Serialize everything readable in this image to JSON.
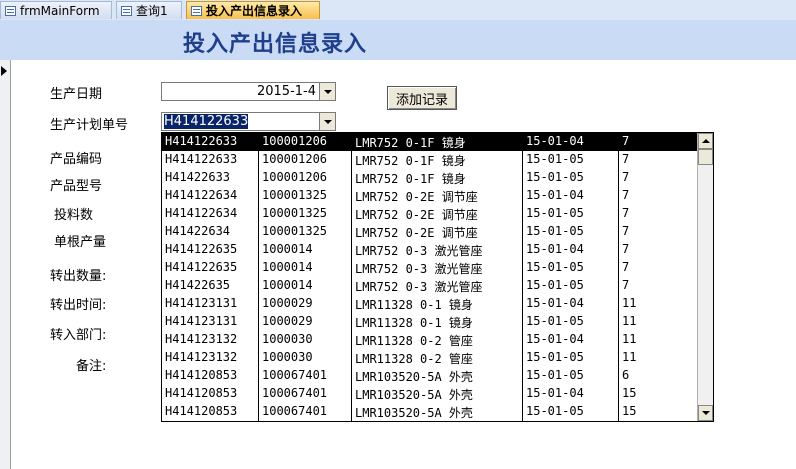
{
  "tabs": [
    {
      "label": "frmMainForm",
      "active": false
    },
    {
      "label": "查询1",
      "active": false
    },
    {
      "label": "投入产出信息录入",
      "active": true
    }
  ],
  "form": {
    "title": "投入产出信息录入",
    "labels": {
      "date": "生产日期",
      "plan_no": "生产计划单号",
      "product_code": "产品编码",
      "product_model": "产品型号",
      "input_qty": "投料数",
      "single_output": "单根产量",
      "transfer_qty": "转出数量:",
      "transfer_time": "转出时间:",
      "dept": "转入部门:",
      "remark": "备注:"
    },
    "date_value": "2015-1-4",
    "plan_value": "H414122633",
    "add_button": "添加记录"
  },
  "list": {
    "rows": [
      [
        "H414122633",
        "100001206",
        "LMR752 0-1F 镜身",
        "15-01-04",
        "7"
      ],
      [
        "H414122633",
        "100001206",
        "LMR752 0-1F 镜身",
        "15-01-05",
        "7"
      ],
      [
        "H41422633",
        "100001206",
        "LMR752 0-1F 镜身",
        "15-01-05",
        "7"
      ],
      [
        "H414122634",
        "100001325",
        "LMR752 0-2E 调节座",
        "15-01-04",
        "7"
      ],
      [
        "H414122634",
        "100001325",
        "LMR752 0-2E 调节座",
        "15-01-05",
        "7"
      ],
      [
        "H41422634",
        "100001325",
        "LMR752 0-2E 调节座",
        "15-01-05",
        "7"
      ],
      [
        "H414122635",
        "1000014",
        "LMR752 0-3 激光管座",
        "15-01-04",
        "7"
      ],
      [
        "H414122635",
        "1000014",
        "LMR752 0-3 激光管座",
        "15-01-05",
        "7"
      ],
      [
        "H41422635",
        "1000014",
        "LMR752 0-3 激光管座",
        "15-01-05",
        "7"
      ],
      [
        "H414123131",
        "1000029",
        "LMR11328 0-1 镜身",
        "15-01-04",
        "11"
      ],
      [
        "H414123131",
        "1000029",
        "LMR11328 0-1 镜身",
        "15-01-05",
        "11"
      ],
      [
        "H414123132",
        "1000030",
        "LMR11328 0-2 管座",
        "15-01-04",
        "11"
      ],
      [
        "H414123132",
        "1000030",
        "LMR11328 0-2 管座",
        "15-01-05",
        "11"
      ],
      [
        "H414120853",
        "100067401",
        "LMR103520-5A 外壳",
        "15-01-05",
        "6"
      ],
      [
        "H414120853",
        "100067401",
        "LMR103520-5A 外壳",
        "15-01-04",
        "15"
      ],
      [
        "H414120853",
        "100067401",
        "LMR103520-5A 外壳",
        "15-01-05",
        "15"
      ]
    ]
  }
}
